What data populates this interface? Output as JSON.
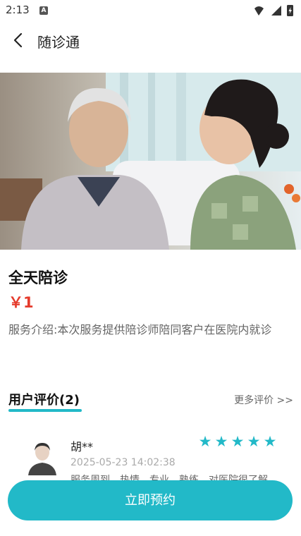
{
  "status_bar": {
    "time": "2:13",
    "notification_letter": "A"
  },
  "app_bar": {
    "title": "随诊通"
  },
  "hero": {
    "description": ""
  },
  "service": {
    "title": "全天陪诊",
    "price": "￥1",
    "description": "服务介绍:本次服务提供陪诊师陪同客户在医院内就诊"
  },
  "reviews": {
    "title": "用户评价(2)",
    "more_label": "更多评价 >>",
    "items": [
      {
        "name": "胡**",
        "rating": 5,
        "date": "2025-05-23 14:02:38",
        "text": "服务周到　热情　专业　熟练　对医院很了解"
      }
    ]
  },
  "book_button": {
    "label": "立即预约"
  },
  "colors": {
    "accent": "#22b9c8",
    "price": "#e53b2c"
  }
}
